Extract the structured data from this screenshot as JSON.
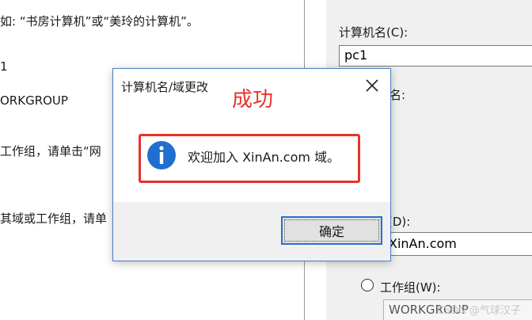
{
  "background_left": {
    "line1": "如: “书房计算机”或“美玲的计算机”。",
    "line2": "1",
    "line3": "ORKGROUP",
    "line4": "工作组，请单击“网",
    "line5": "其域或工作组，请单"
  },
  "background_right": {
    "computer_name_label": "计算机名(C):",
    "computer_name_value": "pc1",
    "full_name_label": "名:",
    "domain_label": "(D):",
    "domain_value": "XinAn.com",
    "workgroup_label": "工作组(W):",
    "workgroup_value": "WORKGROUP"
  },
  "dialog": {
    "title": "计算机名/域更改",
    "annotation": "成功",
    "message": "欢迎加入 XinAn.com 域。",
    "ok_label": "确定",
    "icon": "info-icon",
    "close_icon": "close-icon"
  },
  "watermark": "CSDN @气球汉子",
  "colors": {
    "annotation": "#e8322b",
    "info_icon": "#1f6fd0",
    "dialog_border": "#4a7fc1",
    "button_border": "#2a6fc9"
  }
}
